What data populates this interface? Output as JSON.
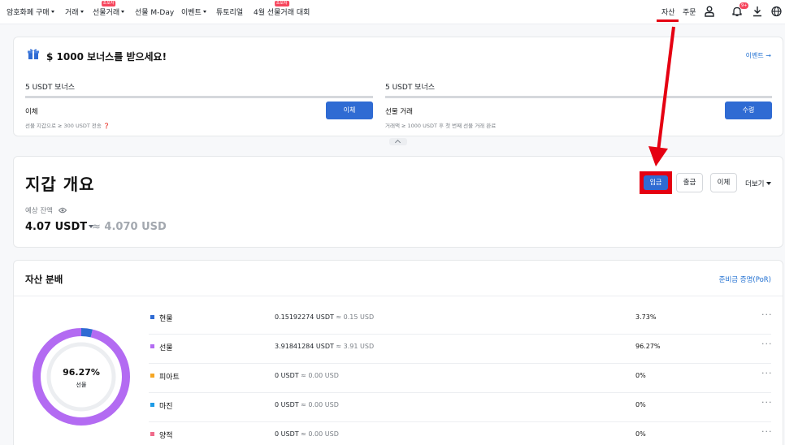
{
  "nav": {
    "items": [
      {
        "label": "암호화폐 구매",
        "caret": true
      },
      {
        "label": "거래",
        "caret": true
      },
      {
        "label": "선물거래",
        "caret": true,
        "badge": "초보자"
      },
      {
        "label": "선물 M-Day",
        "caret": false
      },
      {
        "label": "이벤트",
        "caret": true
      },
      {
        "label": "튜토리얼",
        "caret": false
      },
      {
        "label": "4월 선물거래 대회",
        "caret": false,
        "badge": "초보자"
      }
    ],
    "assets": "자산",
    "orders": "주문",
    "bell_badge": "9+",
    "icons": [
      "user-icon",
      "bell-icon",
      "download-icon",
      "globe-icon"
    ]
  },
  "bonus": {
    "title": "$ 1000 보너스를 받으세요!",
    "event_link": "이벤트 →",
    "tasks": [
      {
        "head": "5 USDT 보너스",
        "name": "이체",
        "desc": "선물 지갑으로 ≥ 300 USDT 전송 ❓",
        "button": "이체"
      },
      {
        "head": "5 USDT 보너스",
        "name": "선물 거래",
        "desc": "거래액 ≥ 1000 USDT 후 첫 번째 선물 거래 완료",
        "button": "수령"
      }
    ]
  },
  "wallet": {
    "title": "지갑 개요",
    "deposit": "입금",
    "withdraw": "출금",
    "transfer": "이체",
    "more": "더보기",
    "balance_label": "예상 잔액",
    "balance_value": "4.07 USDT",
    "balance_approx": "≈ 4.070 USD"
  },
  "distribution": {
    "title": "자산 분배",
    "por_link": "준비금 증명(PoR)",
    "donut_pct": "96.27%",
    "donut_label": "선물",
    "rows": [
      {
        "name": "현물",
        "amount": "0.15192274 USDT",
        "usd": " ≈ 0.15 USD",
        "pct": "3.73%",
        "color": "#2f6bd3"
      },
      {
        "name": "선물",
        "amount": "3.91841284 USDT",
        "usd": " ≈ 3.91 USD",
        "pct": "96.27%",
        "color": "#b36bf2"
      },
      {
        "name": "피아트",
        "amount": "0 USDT",
        "usd": " ≈ 0.00 USD",
        "pct": "0%",
        "color": "#f5a623"
      },
      {
        "name": "마진",
        "amount": "0 USDT",
        "usd": " ≈ 0.00 USD",
        "pct": "0%",
        "color": "#1e9be6"
      },
      {
        "name": "양적",
        "amount": "0 USDT",
        "usd": " ≈ 0.00 USD",
        "pct": "0%",
        "color": "#f06a8a"
      }
    ],
    "more_glyph": "···"
  },
  "colors": {
    "primary": "#2f6bd3",
    "link": "#1f6fd1",
    "annotation": "#e50012",
    "donut_futures": "#b36bf2",
    "donut_spot": "#2f6bd3"
  }
}
